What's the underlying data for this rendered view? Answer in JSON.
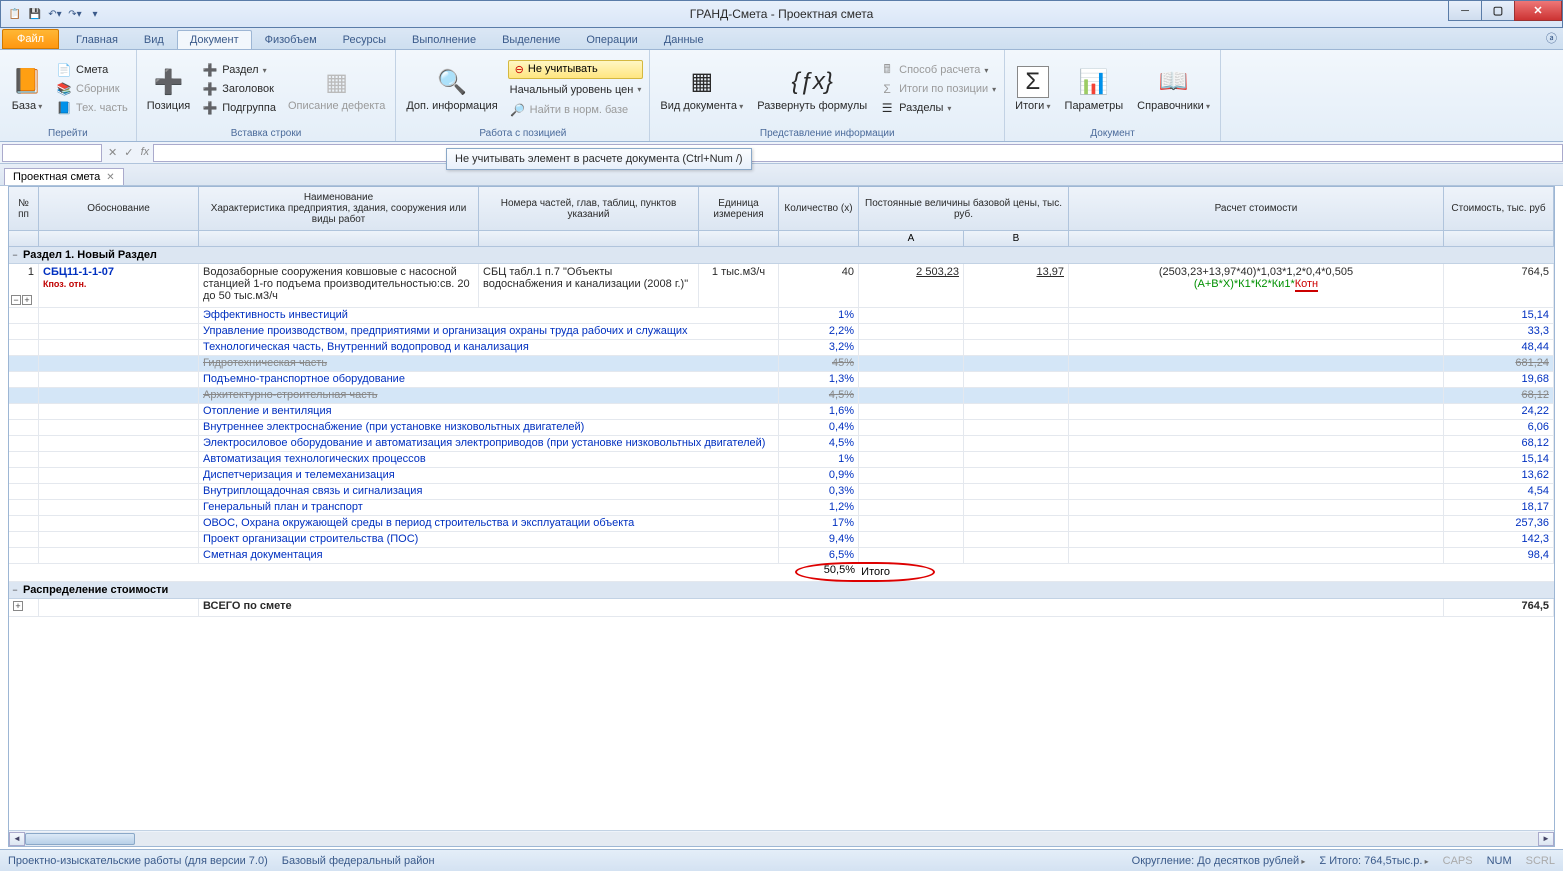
{
  "title": "ГРАНД-Смета - Проектная смета",
  "tabs": {
    "file": "Файл",
    "glav": "Главная",
    "vid": "Вид",
    "doc": "Документ",
    "fiz": "Физобъем",
    "res": "Ресурсы",
    "vyp": "Выполнение",
    "vyd": "Выделение",
    "oper": "Операции",
    "dan": "Данные"
  },
  "ribbon": {
    "g1": {
      "label": "Перейти",
      "baza": "База",
      "smeta": "Смета",
      "sbornik": "Сборник",
      "tex": "Тех. часть"
    },
    "g2": {
      "label": "Вставка строки",
      "poz": "Позиция",
      "razd": "Раздел",
      "zag": "Заголовок",
      "pod": "Подгруппа",
      "opis": "Описание дефекта"
    },
    "g3": {
      "label": "Работа с позицией",
      "dop": "Доп. информация",
      "neuch": "Не учитывать",
      "nach": "Начальный уровень цен",
      "naiti": "Найти в норм. базе"
    },
    "g4": {
      "label": "Представление информации",
      "vid": "Вид документа",
      "razv": "Развернуть формулы",
      "sposob": "Способ расчета",
      "itogi": "Итоги по позиции",
      "razd": "Разделы"
    },
    "g5": {
      "label": "Документ",
      "itogi": "Итоги",
      "param": "Параметры",
      "sprav": "Справочники"
    }
  },
  "tooltip": "Не учитывать элемент в расчете документа (Ctrl+Num /)",
  "dtab": "Проектная смета",
  "headers": {
    "pp": "№ пп",
    "obos": "Обоснование",
    "naim": "Наименование\nХарактеристика предприятия, здания, сооружения или виды работ",
    "nom": "Номера частей, глав, таблиц, пунктов указаний",
    "ed": "Единица измерения",
    "kol": "Количество (x)",
    "post": "Постоянные величины базовой цены, тыс. руб.",
    "a": "A",
    "b": "B",
    "rasch": "Расчет стоимости",
    "st": "Стоимость, тыс. руб"
  },
  "section1": "Раздел 1. Новый Раздел",
  "main": {
    "n": "1",
    "code": "СБЦ11-1-1-07",
    "k": "Кпоз. отн.",
    "naim": "Водозаборные сооружения ковшовые с насосной станцией 1-го подъема производительностью:св. 20 до 50 тыс.м3/ч",
    "nom": "СБЦ табл.1 п.7 \"Объекты водоснабжения и канализации (2008 г.)\"",
    "ed": "1 тыс.м3/ч",
    "kol": "40",
    "a": "2 503,23",
    "b": "13,97",
    "rasch": "(2503,23+13,97*40)*1,03*1,2*0,4*0,505",
    "form": "(A+B*X)*К1*К2*Ки1*",
    "kotn": "Котн",
    "st": "764,5"
  },
  "rows": [
    {
      "n": "Эффективность инвестиций",
      "k": "1%",
      "s": "15,14"
    },
    {
      "n": "Управление производством, предприятиями и организация охраны труда рабочих и служащих",
      "k": "2,2%",
      "s": "33,3"
    },
    {
      "n": "Технологическая часть, Внутренний водопровод и канализация",
      "k": "3,2%",
      "s": "48,44"
    },
    {
      "n": "Гидротехническая часть",
      "k": "45%",
      "s": "681,24",
      "strike": true,
      "sel": true
    },
    {
      "n": "Подъемно-транспортное оборудование",
      "k": "1,3%",
      "s": "19,68"
    },
    {
      "n": "Архитектурно-строительная часть",
      "k": "4,5%",
      "s": "68,12",
      "strike": true,
      "sel": true
    },
    {
      "n": "Отопление и вентиляция",
      "k": "1,6%",
      "s": "24,22"
    },
    {
      "n": "Внутреннее электроснабжение (при установке низковольтных двигателей)",
      "k": "0,4%",
      "s": "6,06"
    },
    {
      "n": "Электросиловое оборудование и автоматизация электроприводов (при установке низковольтных двигателей)",
      "k": "4,5%",
      "s": "68,12"
    },
    {
      "n": "Автоматизация технологических процессов",
      "k": "1%",
      "s": "15,14"
    },
    {
      "n": "Диспетчеризация и телемеханизация",
      "k": "0,9%",
      "s": "13,62"
    },
    {
      "n": "Внутриплощадочная связь и сигнализация",
      "k": "0,3%",
      "s": "4,54"
    },
    {
      "n": "Генеральный план и транспорт",
      "k": "1,2%",
      "s": "18,17"
    },
    {
      "n": "ОВОС, Охрана окружающей среды в период строительства и эксплуатации объекта",
      "k": "17%",
      "s": "257,36"
    },
    {
      "n": "Проект организации строительства (ПОС)",
      "k": "9,4%",
      "s": "142,3"
    },
    {
      "n": "Сметная документация",
      "k": "6,5%",
      "s": "98,4"
    }
  ],
  "itogo": {
    "label": "Итого",
    "val": "50,5%"
  },
  "section2": "Распределение стоимости",
  "total": {
    "label": "ВСЕГО по смете",
    "val": "764,5"
  },
  "status": {
    "l1": "Проектно-изыскательские работы (для версии 7.0)",
    "l2": "Базовый федеральный район",
    "okr": "Округление: До десятков рублей",
    "sum": "Итого: 764,5тыс.р.",
    "caps": "CAPS",
    "num": "NUM",
    "scrl": "SCRL"
  }
}
